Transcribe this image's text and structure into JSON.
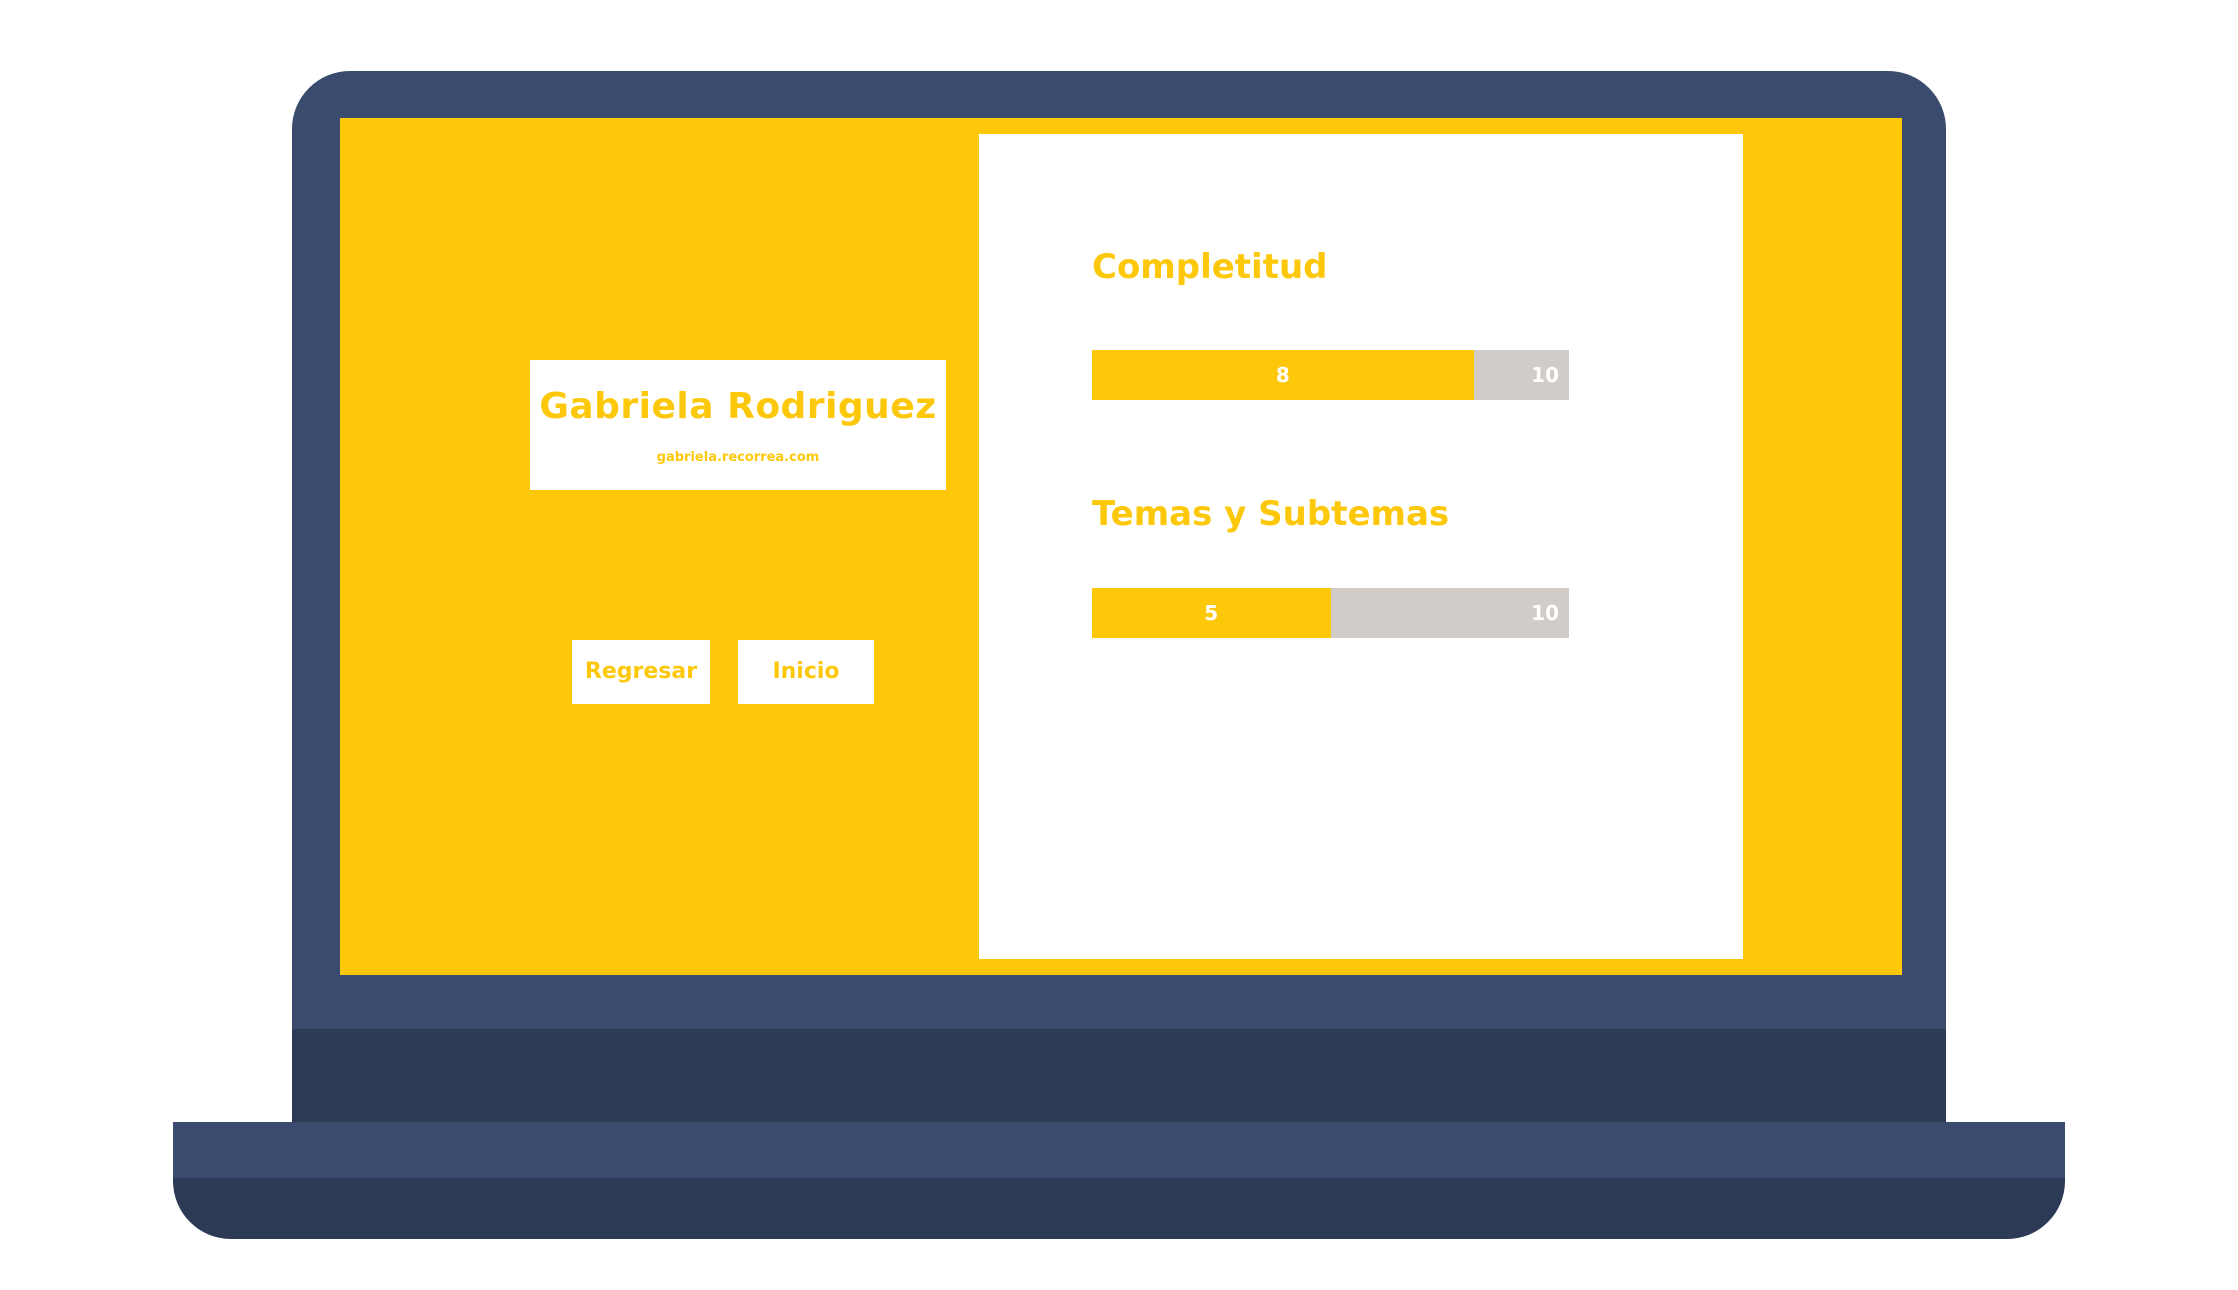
{
  "colors": {
    "accent": "#fec80a",
    "laptop_frame": "#3b4b6e",
    "laptop_shadow": "#2c3a55",
    "bar_track": "#d2ccc9",
    "panel": "#ffffff"
  },
  "profile": {
    "name": "Gabriela Rodriguez",
    "email": "gabriela.recorrea.com"
  },
  "buttons": {
    "back_label": "Regresar",
    "home_label": "Inicio"
  },
  "progress": [
    {
      "title": "Completitud",
      "value": 8,
      "max": 10,
      "value_label": "8",
      "max_label": "10"
    },
    {
      "title": "Temas y Subtemas",
      "value": 5,
      "max": 10,
      "value_label": "5",
      "max_label": "10"
    }
  ]
}
